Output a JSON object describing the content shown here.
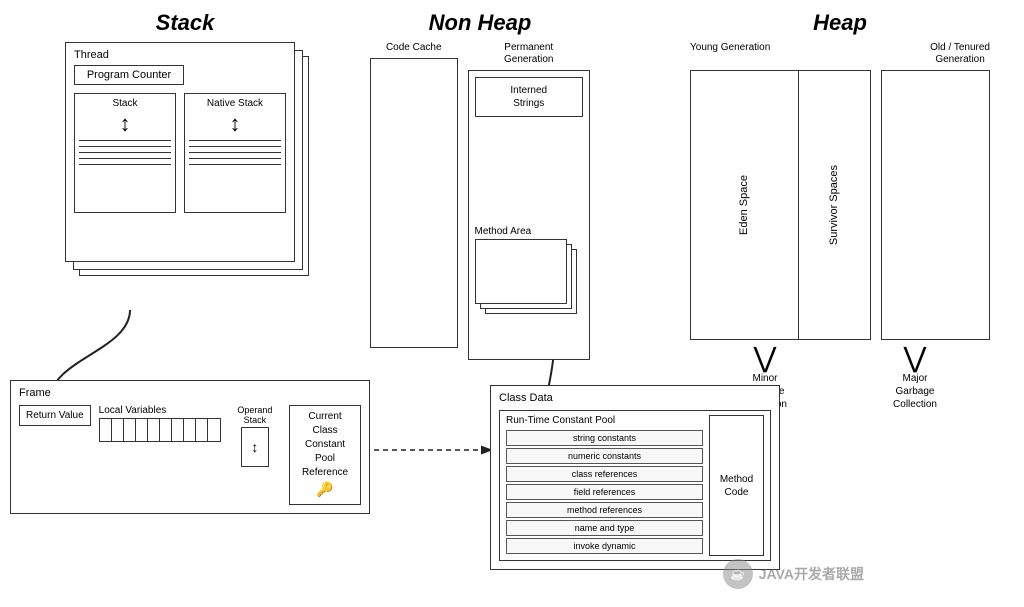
{
  "stack": {
    "title": "Stack",
    "thread_label": "Thread",
    "program_counter": "Program Counter",
    "stack_label": "Stack",
    "native_stack_label": "Native Stack",
    "frame_label": "Frame",
    "return_value_label": "Return Value",
    "local_variables_label": "Local Variables",
    "operand_stack_label": "Operand Stack",
    "current_class_label": "Current Class\nConstant Pool\nReference"
  },
  "non_heap": {
    "title": "Non Heap",
    "code_cache_label": "Code Cache",
    "perm_gen_label": "Permanent\nGeneration",
    "interned_strings": "Interned\nStrings",
    "method_area_label": "Method Area"
  },
  "heap": {
    "title": "Heap",
    "young_gen_label": "Young Generation",
    "old_tenured_label": "Old / Tenured\nGeneration",
    "eden_space_label": "Eden Space",
    "survivor_spaces_label": "Survivor Spaces",
    "minor_gc_label": "Minor\nGarbage\nCollection",
    "major_gc_label": "Major\nGarbage\nCollection"
  },
  "class_data": {
    "label": "Class Data",
    "runtime_cp_label": "Run-Time Constant Pool",
    "items": [
      "string constants",
      "numeric constants",
      "class references",
      "field references",
      "method references",
      "name and type",
      "invoke dynamic"
    ],
    "method_code_label": "Method\nCode"
  },
  "watermark": {
    "icon_text": "☕",
    "text": "JAVA开发者联盟"
  }
}
